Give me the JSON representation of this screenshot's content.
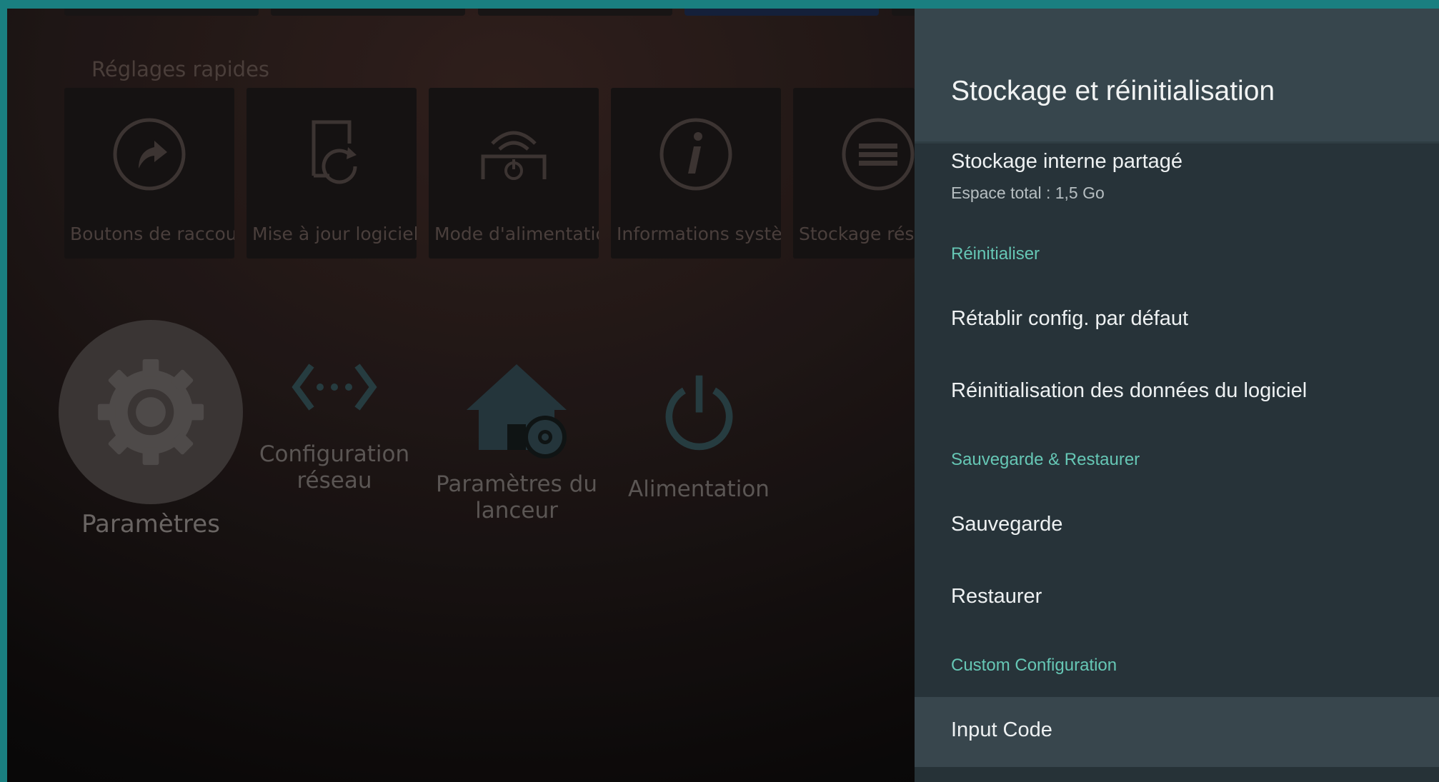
{
  "background": {
    "quick_settings_title": "Réglages rapides",
    "quick_tiles": [
      {
        "icon": "shortcut-arrow-icon",
        "label": "Boutons de raccou..."
      },
      {
        "icon": "software-update-icon",
        "label": "Mise à jour logiciel"
      },
      {
        "icon": "power-mode-icon",
        "label": "Mode d'alimentation"
      },
      {
        "icon": "info-icon",
        "label": "Informations systè..."
      },
      {
        "icon": "storage-menu-icon",
        "label": "Stockage rés"
      }
    ],
    "apps": [
      {
        "icon": "gear-icon",
        "label": "Paramètres"
      },
      {
        "icon": "network-config-icon",
        "label": "Configuration réseau"
      },
      {
        "icon": "launcher-settings-icon",
        "label": "Paramètres du lanceur"
      },
      {
        "icon": "power-icon",
        "label": "Alimentation"
      }
    ]
  },
  "panel": {
    "title": "Stockage et réinitialisation",
    "storage": {
      "title": "Stockage interne partagé",
      "subtitle": "Espace total : 1,5 Go"
    },
    "section_reset": "Réinitialiser",
    "item_restore_defaults": "Rétablir config. par défaut",
    "item_reset_data": "Réinitialisation des données du logiciel",
    "section_backup": "Sauvegarde & Restaurer",
    "item_backup": "Sauvegarde",
    "item_restore": "Restaurer",
    "section_custom": "Custom Configuration",
    "item_input_code": "Input Code"
  },
  "colors": {
    "accent_section": "#66c7b5",
    "panel_bg": "#273339",
    "panel_header": "#37464d",
    "frame": "#1a7f80"
  }
}
